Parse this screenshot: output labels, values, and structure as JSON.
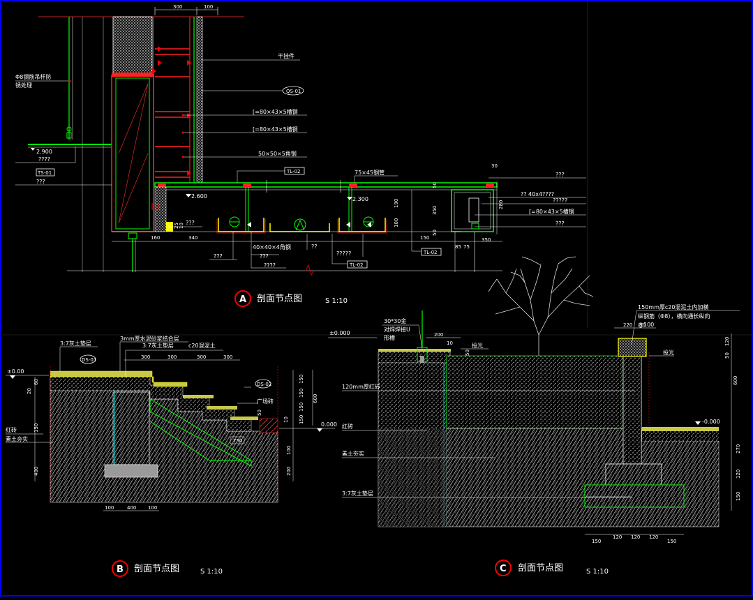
{
  "colors": {
    "background": "#000000",
    "frame": "#0000ff",
    "marker": "#ff0000",
    "structure": "#00ff00",
    "steel": "#ff0000",
    "finish": "#ffff00",
    "concrete": "#e6e6e6",
    "leader": "#ffffff",
    "water": "#00ffff"
  },
  "section_a": {
    "mark": "A",
    "caption": "剖面节点图",
    "scale": "S 1:10",
    "labels": {
      "hanger": "Φ8钢筋吊杆防",
      "hanger2": "锈处理",
      "connector": "干挂件",
      "tag_qs": "QS-01",
      "channel1": "[=80×43×5槽钢",
      "channel2": "[=80×43×5槽钢",
      "angle": "50×50×5角钢",
      "tag_tl02_a": "TL-02",
      "tube": "75×45钢管",
      "right1": "???",
      "right2": "?? 40x4????",
      "right3": "?????",
      "right_channel": "[=80×43×5槽钢",
      "right4": "???",
      "left_q1": "????",
      "left_q2": "???",
      "tag_ts01": "TS-01",
      "mid_q": "???",
      "angle40": "40×40×4角钢",
      "q_a": "???",
      "q_b": "??",
      "q_c": "???",
      "q_d": "????",
      "q_e": "?????",
      "tag_tl02_b": "TL-02",
      "tag_tl02_c": "TL-02"
    },
    "levels": [
      "2.900",
      "2.600",
      "2.300"
    ],
    "dims": [
      "300",
      "100",
      "160",
      "340",
      "25",
      "10",
      "190",
      "100",
      "30",
      "50",
      "350",
      "150",
      "50",
      "85",
      "75",
      "350",
      "30",
      "280",
      "50"
    ]
  },
  "section_b": {
    "mark": "B",
    "caption": "剖面节点图",
    "scale": "S 1:10",
    "labels": {
      "lime1": "3:7灰土垫层",
      "mortar": "3mm厚水泥砂浆结合层",
      "lime2": "3:7灰土垫层",
      "concrete": "c20混泥土",
      "tag_ds01": "DS-01",
      "tag_ds02": "DS-02",
      "led": "广场砖",
      "brick": "红砖",
      "soil": "素土夯实"
    },
    "levels": [
      "±0.00",
      "0.000"
    ],
    "dims": [
      "300",
      "300",
      "300",
      "300",
      "20",
      "60",
      "150",
      "150",
      "150",
      "150",
      "600",
      "10",
      "50",
      "750",
      "200",
      "150",
      "100",
      "400",
      "100"
    ]
  },
  "section_c": {
    "mark": "C",
    "caption": "剖面节点图",
    "scale": "S 1:10",
    "labels": {
      "steel_top": "30*30金",
      "steel_top2": "对焊焊接U",
      "steel_top3": "形槽",
      "concrete_note": "150mm厚c20混泥土内加横",
      "concrete_note2": "纵钢筋（Φ8），横向通长纵向",
      "concrete_note3": "@100",
      "light1": "投光",
      "light2": "投光",
      "brick_wall": "120mm厚红砖",
      "brick": "红砖",
      "soil": "素土夯实",
      "lime": "3:7灰土垫层"
    },
    "levels": [
      "±0.000",
      "-0.000"
    ],
    "dims": [
      "200",
      "10",
      "50",
      "220",
      "80",
      "120",
      "50",
      "600",
      "270",
      "120",
      "150",
      "150",
      "120",
      "120",
      "120",
      "150"
    ]
  }
}
